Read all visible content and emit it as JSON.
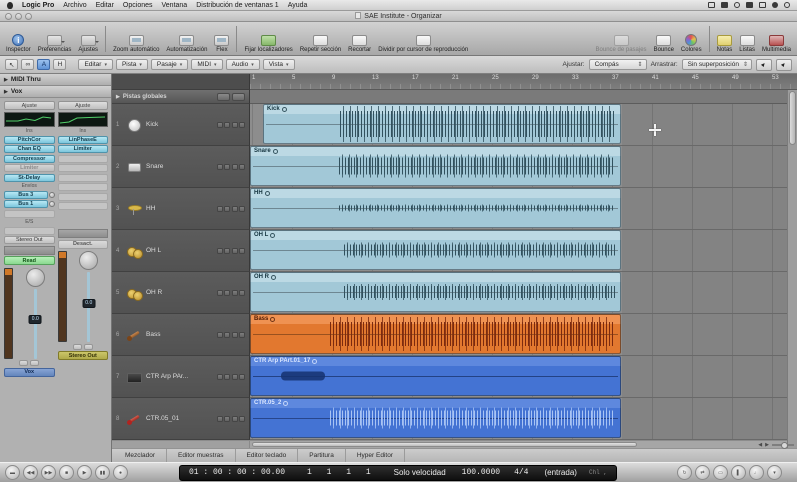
{
  "menubar": {
    "items": [
      "Logic Pro",
      "Archivo",
      "Editar",
      "Opciones",
      "Ventana",
      "Distribución de ventanas 1",
      "Ayuda"
    ]
  },
  "titlebar": {
    "title": "SAE Institute - Organizar"
  },
  "toolbar": {
    "inspector": "Inspector",
    "preferences": "Preferencias",
    "settings": "Ajustes",
    "auto_zoom": "Zoom automático",
    "automation": "Automatización",
    "flex": "Flex",
    "set_locators": "Fijar localizadores",
    "repeat_section": "Repetir sección",
    "crop": "Recortar",
    "split": "Dividir por cursor de reproducción",
    "bounce_regions": "Bounce de pasajes",
    "bounce": "Bounce",
    "colors": "Colores",
    "notes": "Notas",
    "lists": "Listas",
    "media": "Multimedia"
  },
  "arrange_toolbar": {
    "menus": [
      "Editar",
      "Pista",
      "Pasaje",
      "MIDI",
      "Audio",
      "Vista"
    ],
    "snap_label": "Ajustar:",
    "snap_value": "Compás",
    "drag_label": "Arrastrar:",
    "drag_value": "Sin superposición"
  },
  "inspector": {
    "header_midi": "MIDI Thru",
    "header_track": "Vox",
    "strip_left": {
      "setting": "Ajuste",
      "ins_label": "Ins",
      "slot1": "PitchCor",
      "slot2": "Chan EQ",
      "slot3": "Compressor",
      "slot4": "Limiter",
      "slot5": "St-Delay",
      "sends_label": "Envíos",
      "send1": "Bus 3",
      "send2": "Bus 1",
      "io_label": "E/S",
      "output": "Stereo Out",
      "automation": "Read",
      "fader_value": "0.0",
      "name": "Vox"
    },
    "strip_right": {
      "setting": "Ajuste",
      "ins_label": "Ins",
      "slot1": "LinPhaseE",
      "slot2": "Limiter",
      "automation": "Desact.",
      "fader_value": "0.0",
      "name": "Stereo Out"
    }
  },
  "track_area": {
    "global_tracks": "Pistas globales",
    "tracks": [
      {
        "num": "1",
        "name": "Kick"
      },
      {
        "num": "2",
        "name": "Snare"
      },
      {
        "num": "3",
        "name": "HH"
      },
      {
        "num": "4",
        "name": "OH L"
      },
      {
        "num": "5",
        "name": "OH R"
      },
      {
        "num": "6",
        "name": "Bass"
      },
      {
        "num": "7",
        "name": "CTR Arp PAr..."
      },
      {
        "num": "8",
        "name": "CTR.05_01"
      }
    ],
    "ruler": [
      "1",
      "5",
      "9",
      "13",
      "17",
      "21",
      "25",
      "29",
      "33",
      "37",
      "41",
      "45",
      "49",
      "53"
    ],
    "regions": [
      {
        "name": "Kick"
      },
      {
        "name": "Snare"
      },
      {
        "name": "HH"
      },
      {
        "name": "OH L"
      },
      {
        "name": "OH R"
      },
      {
        "name": "Bass"
      },
      {
        "name": "CTR Arp PArt.01_17"
      },
      {
        "name": "CTR.05_2"
      }
    ]
  },
  "bottom_tabs": [
    "Mezclador",
    "Editor muestras",
    "Editor teclado",
    "Partitura",
    "Hyper Editor"
  ],
  "transport": {
    "smpte": "01 : 00 : 00 : 00.00",
    "position": "1 1 1 1",
    "mode": "Solo velocidad",
    "tempo": "100.0000",
    "signature": "4/4",
    "midi_in": "(entrada)",
    "midi_out": "Chl ,"
  },
  "icons": {
    "collapse": "▶",
    "dropdown": "▾",
    "stepper": "⇕",
    "back": "↖",
    "link": "∞",
    "tool_a": "A",
    "tool_h": "H",
    "pointer": "►",
    "t_left": [
      "▬",
      "◀◀",
      "▶▶",
      "■",
      "▶",
      "▮▮",
      "●"
    ],
    "t_right": [
      "↻",
      "⇄",
      "▭",
      "▌",
      "♩",
      "▾"
    ]
  },
  "colors": {
    "region_teal": "#a2c8d7",
    "region_orange": "#e2782f",
    "region_blue": "#4473d3",
    "plugin_cyan": "#7cc6dc",
    "automation_green": "#8ad890"
  }
}
